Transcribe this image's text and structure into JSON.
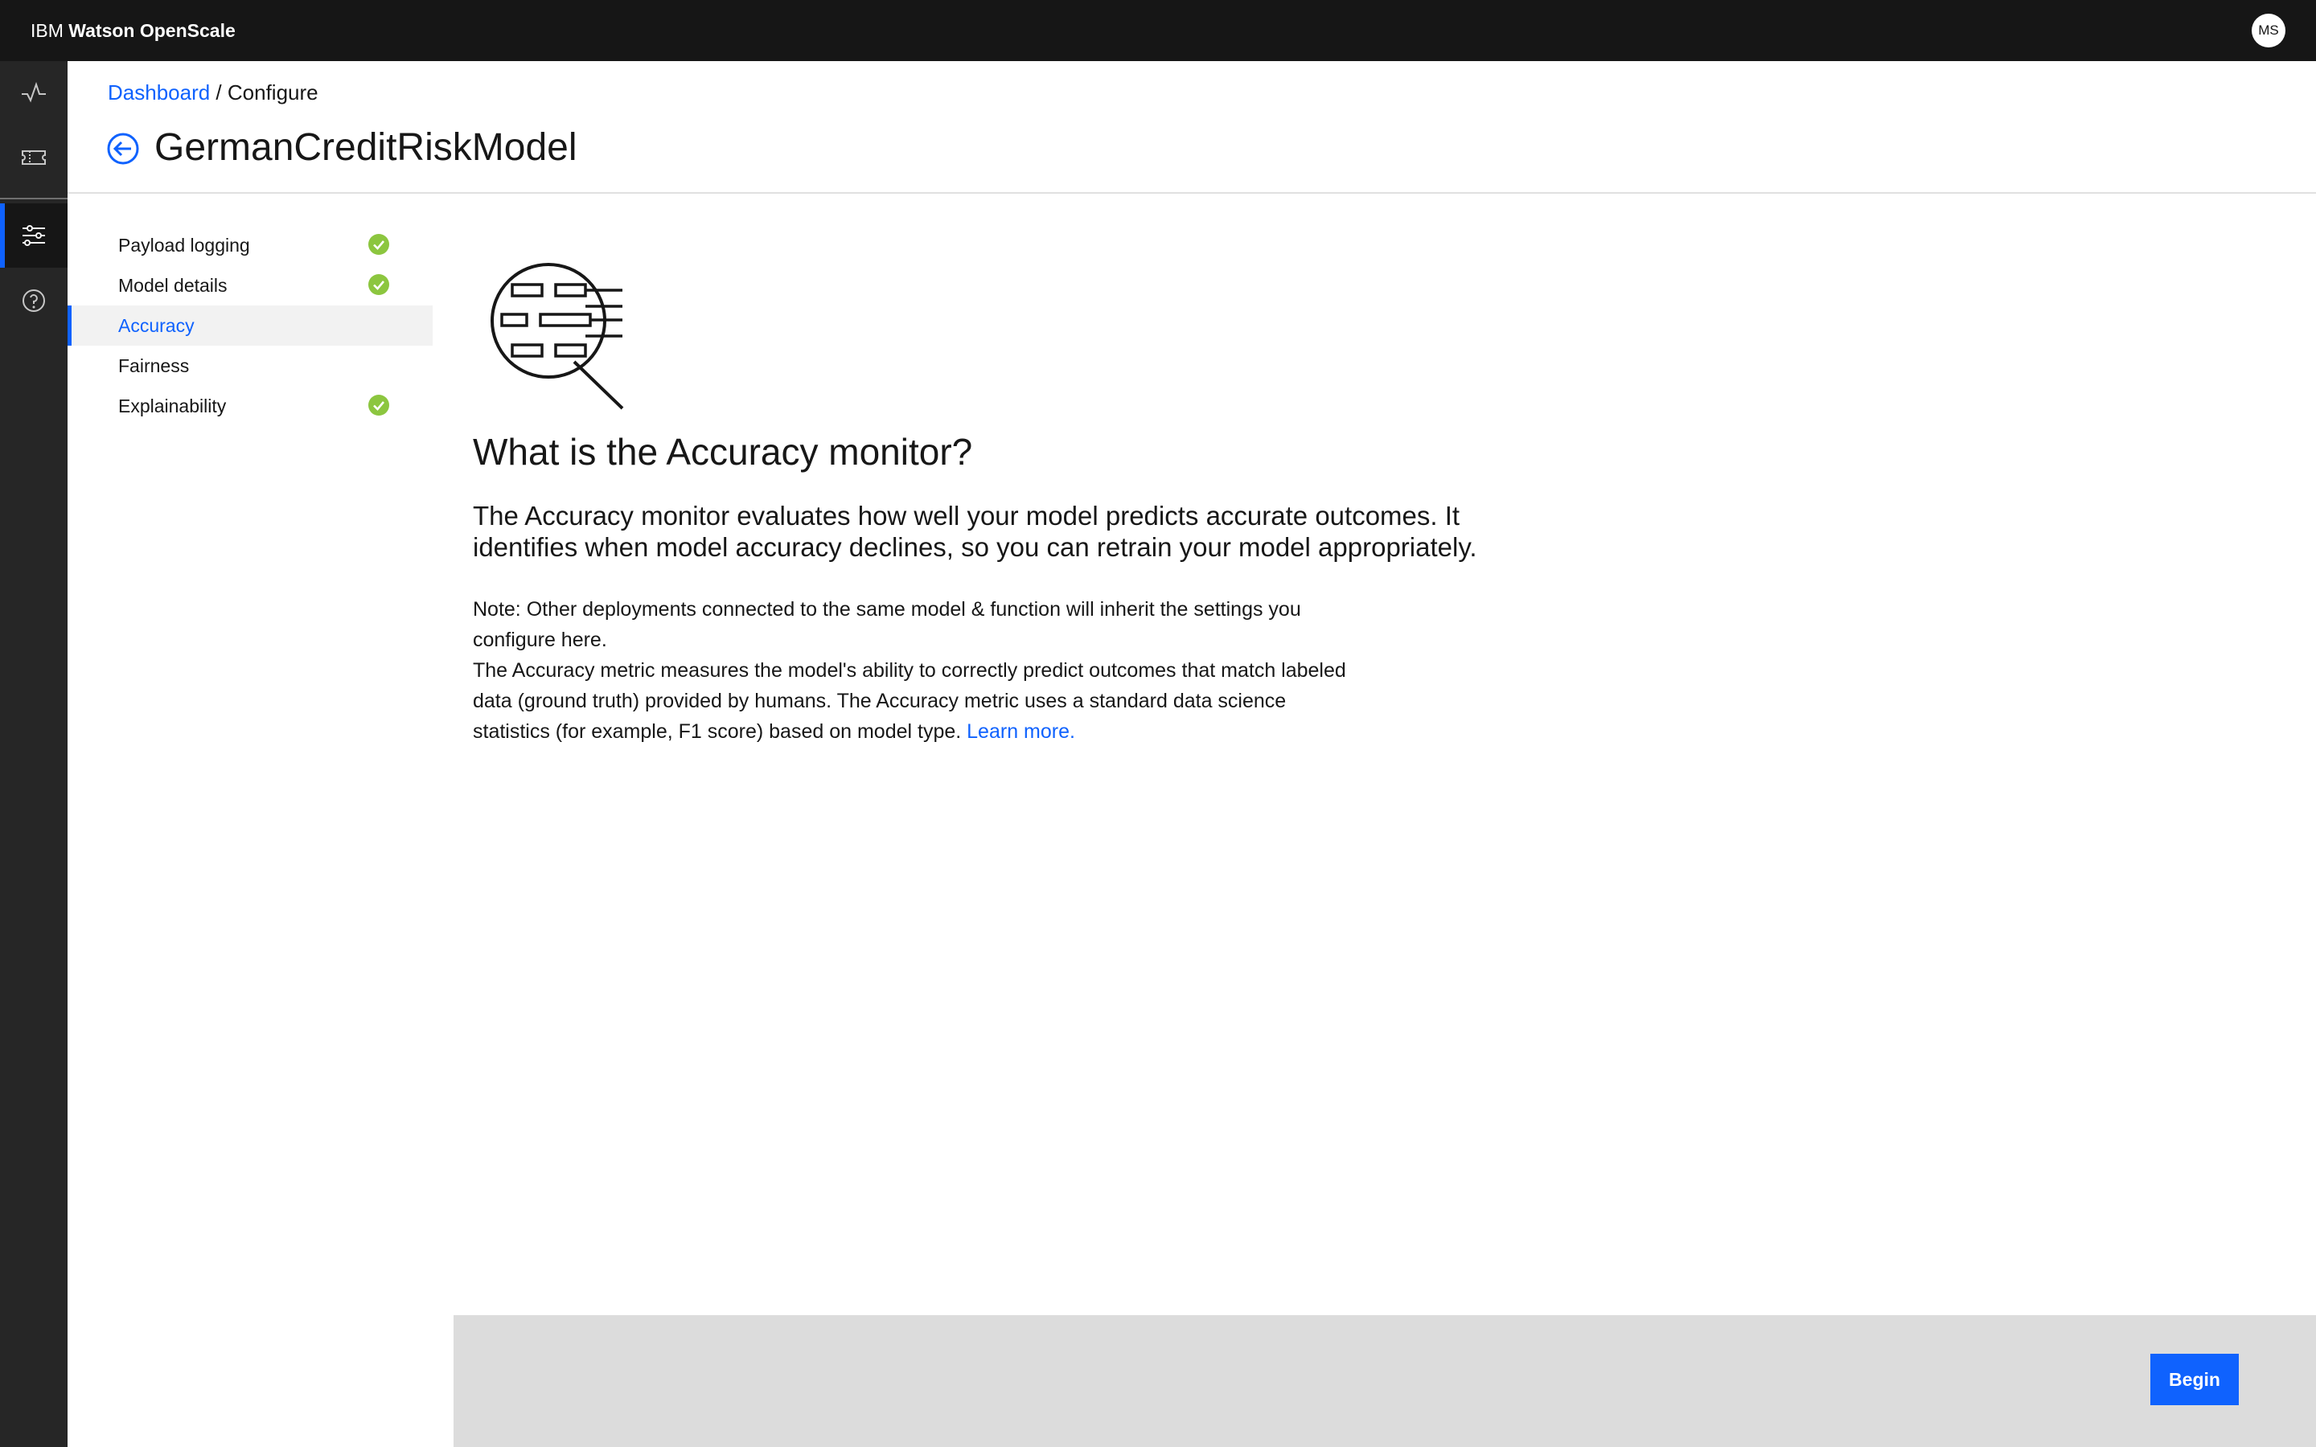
{
  "header": {
    "brand_prefix": "IBM",
    "brand_name": "Watson OpenScale",
    "avatar_initials": "MS"
  },
  "rail": {
    "icons": [
      "activity-icon",
      "ticket-icon",
      "settings-sliders-icon",
      "help-icon"
    ],
    "active_index": 2
  },
  "breadcrumb": {
    "link": "Dashboard",
    "separator": " / ",
    "current": "Configure"
  },
  "page": {
    "title": "GermanCreditRiskModel"
  },
  "steps": [
    {
      "label": "Payload logging",
      "complete": true,
      "active": false
    },
    {
      "label": "Model details",
      "complete": true,
      "active": false
    },
    {
      "label": "Accuracy",
      "complete": false,
      "active": true
    },
    {
      "label": "Fairness",
      "complete": false,
      "active": false
    },
    {
      "label": "Explainability",
      "complete": true,
      "active": false
    }
  ],
  "content": {
    "title": "What is the Accuracy monitor?",
    "lead": "The Accuracy monitor evaluates how well your model predicts accurate outcomes. It identifies when model accuracy declines, so you can retrain your model appropriately.",
    "note": "Note: Other deployments connected to the same model & function will inherit the settings you configure here.",
    "metric_text": "The Accuracy metric measures the model's ability to correctly predict outcomes that match labeled data (ground truth) provided by humans. The Accuracy metric uses a standard data science statistics (for example, F1 score) based on model type.",
    "learn_more": "Learn more."
  },
  "footer": {
    "begin_label": "Begin"
  },
  "colors": {
    "accent": "#0f62fe",
    "success": "#8cc63f",
    "header_bg": "#161616",
    "rail_bg": "#262626",
    "footer_bg": "#dcdcdc"
  }
}
